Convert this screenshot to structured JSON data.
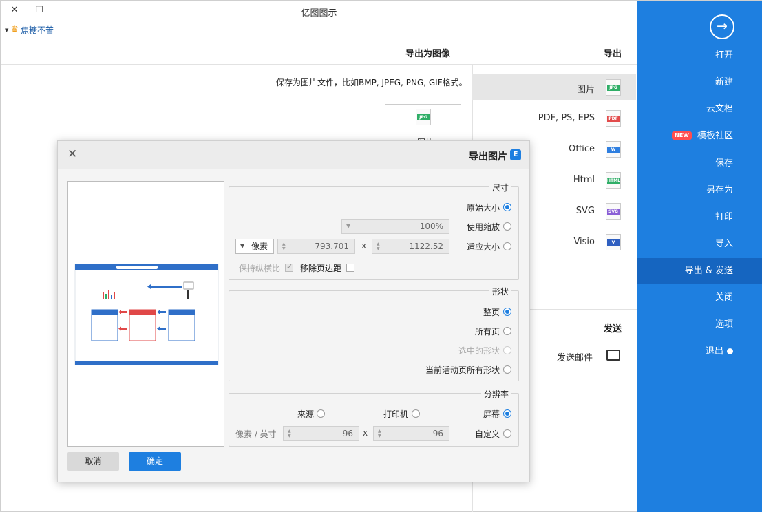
{
  "window": {
    "title": "亿图图示",
    "minimize": "‒",
    "maximize": "☐",
    "close": "✕"
  },
  "user": {
    "name": "焦糖不苦"
  },
  "sidebar": {
    "items": [
      {
        "label": "打开"
      },
      {
        "label": "新建"
      },
      {
        "label": "云文档"
      },
      {
        "label": "模板社区",
        "badge": "NEW"
      },
      {
        "label": "保存"
      },
      {
        "label": "另存为"
      },
      {
        "label": "打印"
      },
      {
        "label": "导入"
      },
      {
        "label": "导出 & 发送",
        "active": true
      },
      {
        "label": "关闭"
      },
      {
        "label": "选项"
      },
      {
        "label": "退出"
      }
    ]
  },
  "export": {
    "title": "导出",
    "formats": [
      {
        "label": "图片",
        "icon": "JPG",
        "color": "#2fae67",
        "active": true
      },
      {
        "label": "PDF, PS, EPS",
        "icon": "PDF",
        "color": "#e24b4b"
      },
      {
        "label": "Office",
        "icon": "W",
        "color": "#2f7fe0"
      },
      {
        "label": "Html",
        "icon": "HTML",
        "color": "#2fae67"
      },
      {
        "label": "SVG",
        "icon": "SVG",
        "color": "#8a5fd6"
      },
      {
        "label": "Visio",
        "icon": "V",
        "color": "#2f5fc0"
      }
    ]
  },
  "send": {
    "title": "发送",
    "email_label": "发送邮件"
  },
  "panel": {
    "title": "导出为图像",
    "description": "保存为图片文件，比如BMP, JPEG, PNG, GIF格式。",
    "card_label": "图片",
    "card_icon": "JPG"
  },
  "dialog": {
    "title": "导出图片",
    "logo": "E",
    "close": "✕",
    "size": {
      "legend": "尺寸",
      "original": "原始大小",
      "zoom": "使用缩放",
      "zoom_value": "100%",
      "fit": "适应大小",
      "width": "1122.52",
      "height": "793.701",
      "times": "x",
      "unit": "像素",
      "remove_margin": "移除页边距",
      "keep_ratio": "保持纵横比"
    },
    "shape": {
      "legend": "形状",
      "whole_page": "整页",
      "all_pages": "所有页",
      "selected": "选中的形状",
      "current_page_all": "当前活动页所有形状"
    },
    "resolution": {
      "legend": "分辨率",
      "screen": "屏幕",
      "printer": "打印机",
      "source": "来源",
      "custom": "自定义",
      "x_value": "96",
      "y_value": "96",
      "times": "x",
      "unit": "像素 / 英寸"
    },
    "ok": "确定",
    "cancel": "取消"
  }
}
